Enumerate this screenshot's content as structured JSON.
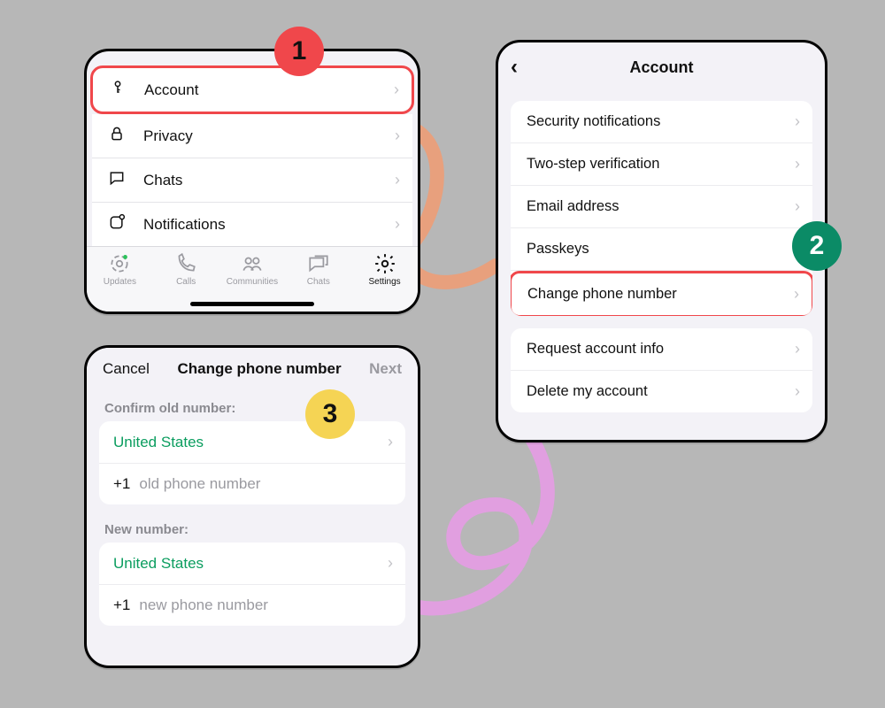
{
  "badges": {
    "one": "1",
    "two": "2",
    "three": "3"
  },
  "panel1": {
    "items": [
      {
        "label": "Account"
      },
      {
        "label": "Privacy"
      },
      {
        "label": "Chats"
      },
      {
        "label": "Notifications"
      }
    ],
    "tabs": [
      {
        "label": "Updates"
      },
      {
        "label": "Calls"
      },
      {
        "label": "Communities"
      },
      {
        "label": "Chats"
      },
      {
        "label": "Settings"
      }
    ]
  },
  "panel2": {
    "title": "Account",
    "groupA": [
      {
        "label": "Security notifications"
      },
      {
        "label": "Two-step verification"
      },
      {
        "label": "Email address"
      },
      {
        "label": "Passkeys"
      },
      {
        "label": "Change phone number"
      }
    ],
    "groupB": [
      {
        "label": "Request account info"
      },
      {
        "label": "Delete my account"
      }
    ]
  },
  "panel3": {
    "cancel": "Cancel",
    "title": "Change phone number",
    "next": "Next",
    "oldLabel": "Confirm old number:",
    "newLabel": "New number:",
    "country": "United States",
    "dial": "+1",
    "oldPlaceholder": "old phone number",
    "newPlaceholder": "new phone number"
  }
}
